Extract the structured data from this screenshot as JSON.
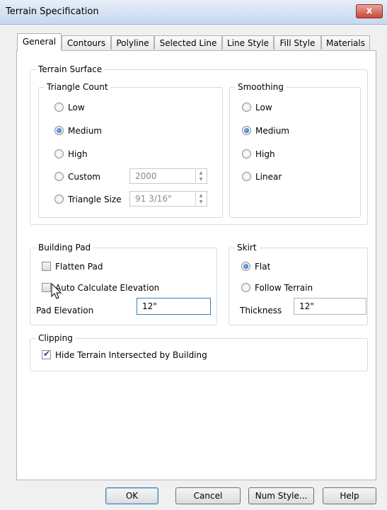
{
  "window": {
    "title": "Terrain Specification",
    "close_label": "x"
  },
  "tabs": [
    {
      "label": "General"
    },
    {
      "label": "Contours"
    },
    {
      "label": "Polyline"
    },
    {
      "label": "Selected Line"
    },
    {
      "label": "Line Style"
    },
    {
      "label": "Fill Style"
    },
    {
      "label": "Materials"
    }
  ],
  "terrain_surface": {
    "title": "Terrain Surface",
    "triangle_count": {
      "title": "Triangle Count",
      "low": "Low",
      "medium": "Medium",
      "high": "High",
      "custom": "Custom",
      "custom_value": "2000",
      "triangle_size": "Triangle Size",
      "triangle_size_value": "91 3/16\"",
      "selected": "Medium"
    },
    "smoothing": {
      "title": "Smoothing",
      "low": "Low",
      "medium": "Medium",
      "high": "High",
      "linear": "Linear",
      "selected": "Medium"
    }
  },
  "building_pad": {
    "title": "Building Pad",
    "flatten_pad": "Flatten Pad",
    "flatten_pad_checked": false,
    "auto_calc": "Auto Calculate Elevation",
    "auto_calc_checked": false,
    "pad_elevation_label": "Pad Elevation",
    "pad_elevation_value": "12\""
  },
  "skirt": {
    "title": "Skirt",
    "flat": "Flat",
    "follow_terrain": "Follow Terrain",
    "selected": "Flat",
    "thickness_label": "Thickness",
    "thickness_value": "12\""
  },
  "clipping": {
    "title": "Clipping",
    "hide_terrain": "Hide Terrain Intersected by Building",
    "hide_terrain_checked": true
  },
  "buttons": {
    "ok": "OK",
    "cancel": "Cancel",
    "num_style": "Num Style...",
    "help": "Help"
  }
}
